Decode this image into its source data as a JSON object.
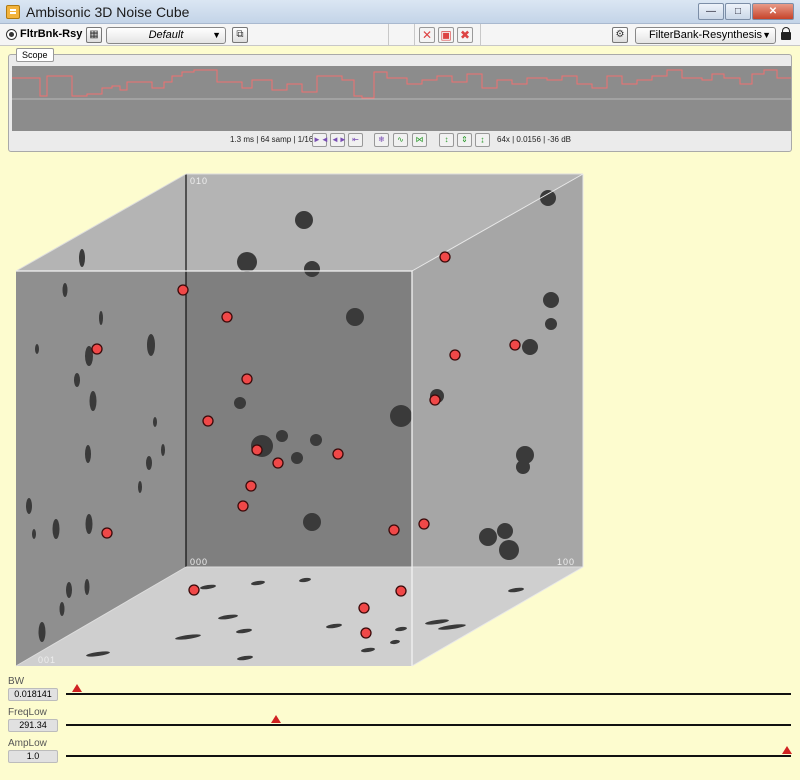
{
  "window": {
    "title": "Ambisonic 3D Noise Cube"
  },
  "toolbar": {
    "plugin_name": "FltrBnk-Rsy",
    "preset": "Default",
    "algorithm": "FilterBank-Resynthesis"
  },
  "scope": {
    "tab_label": "Scope",
    "time_info": "1.3 ms | 64 samp | 1/16x",
    "amp_info": "64x | 0.0156 | -36 dB",
    "trace_color": "#f07070"
  },
  "cube": {
    "labels": {
      "origin": "000",
      "y_axis": "010",
      "x_axis": "100",
      "z_axis": "001"
    },
    "sources_red": [
      [
        183,
        290
      ],
      [
        227,
        317
      ],
      [
        97,
        349
      ],
      [
        247,
        379
      ],
      [
        208,
        421
      ],
      [
        257,
        450
      ],
      [
        278,
        463
      ],
      [
        338,
        454
      ],
      [
        251,
        486
      ],
      [
        243,
        506
      ],
      [
        107,
        533
      ],
      [
        445,
        257
      ],
      [
        455,
        355
      ],
      [
        515,
        345
      ],
      [
        435,
        400
      ],
      [
        394,
        530
      ],
      [
        424,
        524
      ],
      [
        194,
        590
      ],
      [
        401,
        591
      ],
      [
        364,
        608
      ],
      [
        366,
        633
      ]
    ],
    "shadows_back": [
      [
        304,
        220,
        9
      ],
      [
        247,
        262,
        10
      ],
      [
        312,
        269,
        8
      ],
      [
        548,
        198,
        8
      ],
      [
        355,
        317,
        9
      ],
      [
        551,
        300,
        8
      ],
      [
        551,
        324,
        6
      ],
      [
        530,
        347,
        8
      ],
      [
        240,
        403,
        6
      ],
      [
        401,
        416,
        11
      ],
      [
        437,
        396,
        7
      ],
      [
        262,
        446,
        11
      ],
      [
        282,
        436,
        6
      ],
      [
        316,
        440,
        6
      ],
      [
        297,
        458,
        6
      ],
      [
        312,
        522,
        9
      ],
      [
        525,
        455,
        9
      ],
      [
        523,
        467,
        7
      ],
      [
        488,
        537,
        9
      ],
      [
        505,
        531,
        8
      ],
      [
        509,
        550,
        10
      ]
    ],
    "shadows_left": [
      [
        82,
        258,
        3,
        9
      ],
      [
        65,
        290,
        2.5,
        7
      ],
      [
        101,
        318,
        2,
        7
      ],
      [
        37,
        349,
        2,
        5
      ],
      [
        151,
        345,
        4,
        11
      ],
      [
        89,
        356,
        4,
        10
      ],
      [
        77,
        380,
        3,
        7
      ],
      [
        93,
        401,
        3.5,
        10
      ],
      [
        155,
        422,
        2,
        5
      ],
      [
        88,
        454,
        3,
        9
      ],
      [
        149,
        463,
        3,
        7
      ],
      [
        163,
        450,
        2,
        6
      ],
      [
        140,
        487,
        2,
        6
      ],
      [
        29,
        506,
        3,
        8
      ],
      [
        56,
        529,
        3.5,
        10
      ],
      [
        89,
        524,
        3.5,
        10
      ],
      [
        34,
        534,
        2,
        5
      ],
      [
        69,
        590,
        3,
        8
      ],
      [
        62,
        609,
        2.5,
        7
      ],
      [
        87,
        587,
        2.5,
        8
      ],
      [
        42,
        632,
        3.5,
        10
      ]
    ],
    "shadows_floor": [
      [
        208,
        587,
        8,
        2
      ],
      [
        258,
        583,
        7,
        2
      ],
      [
        188,
        637,
        13,
        2
      ],
      [
        228,
        617,
        10,
        2
      ],
      [
        244,
        631,
        8,
        2
      ],
      [
        334,
        626,
        8,
        2
      ],
      [
        98,
        654,
        12,
        2
      ],
      [
        245,
        658,
        8,
        2
      ],
      [
        437,
        622,
        12,
        2
      ],
      [
        452,
        627,
        14,
        2
      ],
      [
        516,
        590,
        8,
        2
      ],
      [
        368,
        650,
        7,
        2
      ],
      [
        401,
        629,
        6,
        2
      ],
      [
        395,
        642,
        5,
        2
      ],
      [
        305,
        580,
        6,
        2
      ]
    ]
  },
  "params": [
    {
      "label": "BW",
      "value": "0.018141",
      "position": 0.015
    },
    {
      "label": "FreqLow",
      "value": "291.34",
      "position": 0.289
    },
    {
      "label": "AmpLow",
      "value": "1.0",
      "position": 1.0
    }
  ]
}
